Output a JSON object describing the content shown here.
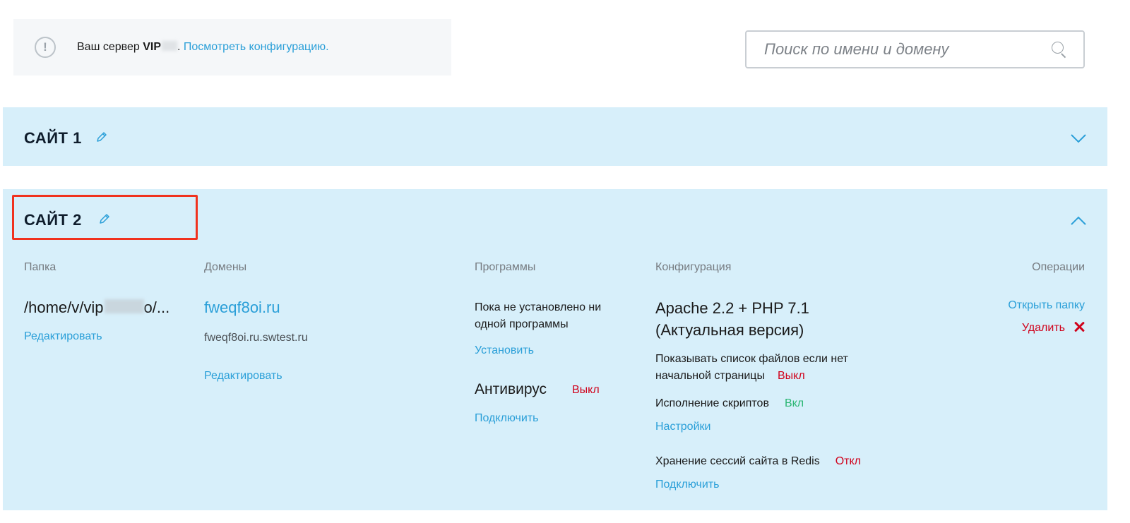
{
  "notice": {
    "text": "Ваш сервер",
    "server": "VIP",
    "link": "Посмотреть конфигурацию."
  },
  "search": {
    "placeholder": "Поиск по имени и домену"
  },
  "sites": [
    {
      "title": "САЙТ 1",
      "expanded": false
    },
    {
      "title": "САЙТ 2",
      "expanded": true
    }
  ],
  "columns": {
    "folder": "Папка",
    "domains": "Домены",
    "programs": "Программы",
    "config": "Конфигурация",
    "operations": "Операции"
  },
  "folder": {
    "path_start": "/home/v/vip",
    "path_end": "o/...",
    "edit": "Редактировать"
  },
  "domains": {
    "main": "fweqf8oi.ru",
    "alias": "fweqf8oi.ru.swtest.ru",
    "edit": "Редактировать"
  },
  "programs": {
    "none_line1": "Пока не установлено ни",
    "none_line2": "одной программы",
    "install": "Установить",
    "antivirus": "Антивирус",
    "antivirus_status": "Выкл",
    "antivirus_connect": "Подключить"
  },
  "config": {
    "stack_line1": "Apache 2.2 + PHP 7.1",
    "stack_line2": "(Актуальная версия)",
    "listing_line1": "Показывать список файлов если нет",
    "listing_line2": "начальной страницы",
    "listing_status": "Выкл",
    "scripts": "Исполнение скриптов",
    "scripts_status": "Вкл",
    "settings": "Настройки",
    "redis": "Хранение сессий сайта в Redis",
    "redis_status": "Откл",
    "redis_connect": "Подключить"
  },
  "operations": {
    "open_folder": "Открыть папку",
    "delete": "Удалить"
  },
  "colors": {
    "accent": "#2a9fd8",
    "section_bg": "#d7effa",
    "off": "#d0021b",
    "on": "#2bb673",
    "highlight": "#f0321e"
  }
}
